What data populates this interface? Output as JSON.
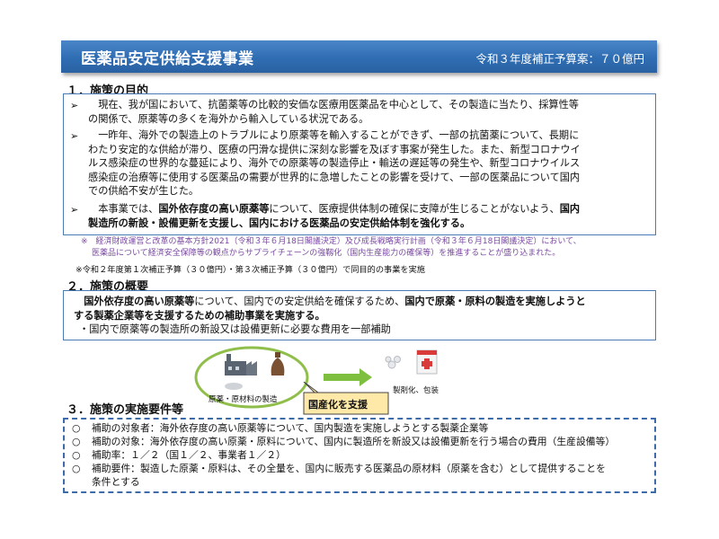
{
  "header": {
    "title": "医薬品安定供給支援事業",
    "budget": "令和３年度補正予算案：７０億円"
  },
  "section1": {
    "title": "１．施策の目的",
    "paragraphs": [
      [
        "　現在、我が国において、抗菌薬等の比較的安価な医療用医薬品を中心として、その製造に当たり、採算性等",
        "の関係で、原薬等の多くを海外から輸入している状況である。"
      ],
      [
        "　一昨年、海外での製造上のトラブルにより原薬等を輸入することができず、一部の抗菌薬について、長期に",
        "わたり安定的な供給が滞り、医療の円滑な提供に深刻な影響を及ぼす事案が発生した。また、新型コロナウイ",
        "ルス感染症の世界的な蔓延により、海外での原薬等の製造停止・輸送の遅延等の発生や、新型コロナウイルス",
        "感染症の治療等に使用する医薬品の需要が世界的に急増したことの影響を受けて、一部の医薬品について国内",
        "での供給不安が生じた。"
      ],
      [
        "　本事業では、",
        "国外依存度の高い原薬等",
        "について、医療提供体制の確保に支障が生じることがないよう、",
        "国内",
        "製造所の新設・設備更新を支援し、国内における医薬品の安定供給体制を強化する。"
      ]
    ],
    "note_a": [
      "※　経済財政運営と改革の基本方針2021（令和３年６月18日閣議決定）及び成長戦略実行計画（令和３年６月18日閣議決定）において、",
      "医薬品について経済安全保障等の観点からサプライチェーンの強靱化（国内生産能力の確保等）を推進することが盛り込まれた。"
    ],
    "note_b": "※令和２年度第１次補正予算（３０億円）・第３次補正予算（３０億円）で同目的の事業を実施"
  },
  "section2": {
    "title": "２．施策の概要",
    "bold1": "国外依存度の高い原薬等",
    "text1": "について、国内での安定供給を確保するため、",
    "bold2": "国内で原薬・原料の製造を実施しようと",
    "bold3": "する製薬企業等を支援するための補助事業を実施する。",
    "sub": "・国内で原薬等の製造所の新設又は設備更新に必要な費用を一部補助"
  },
  "diagram": {
    "left_caption": "原薬・原材料の製造",
    "right_caption": "製剤化、包装",
    "callout": "国産化を支援"
  },
  "section3": {
    "title": "３．施策の実施要件等",
    "mark": "○",
    "rows": [
      "補助の対象者：海外依存度の高い原薬等について、国内製造を実施しようとする製薬企業等",
      "補助の対象：海外依存度の高い原薬・原料について、国内に製造所を新設又は設備更新を行う場合の費用（生産設備等）",
      "補助率：１／２（国１／２、事業者１／２）",
      "補助要件：製造した原薬・原料は、その全量を、国内に販売する医薬品の原材料（原薬を含む）として提供することを",
      "条件とする"
    ]
  },
  "colors": {
    "header_blue": "#2f6db3",
    "box_border": "#4a7bb5",
    "note_purple": "#7a4aa0",
    "circle_green": "#8fbf4a",
    "arrow_green": "#7fbf3f",
    "callout_fill": "#ffe9a8"
  },
  "icons": [
    "factory-icon",
    "flask-icon",
    "powder-icon",
    "tablets-icon",
    "medicine-box-icon",
    "arrow-right-icon"
  ]
}
